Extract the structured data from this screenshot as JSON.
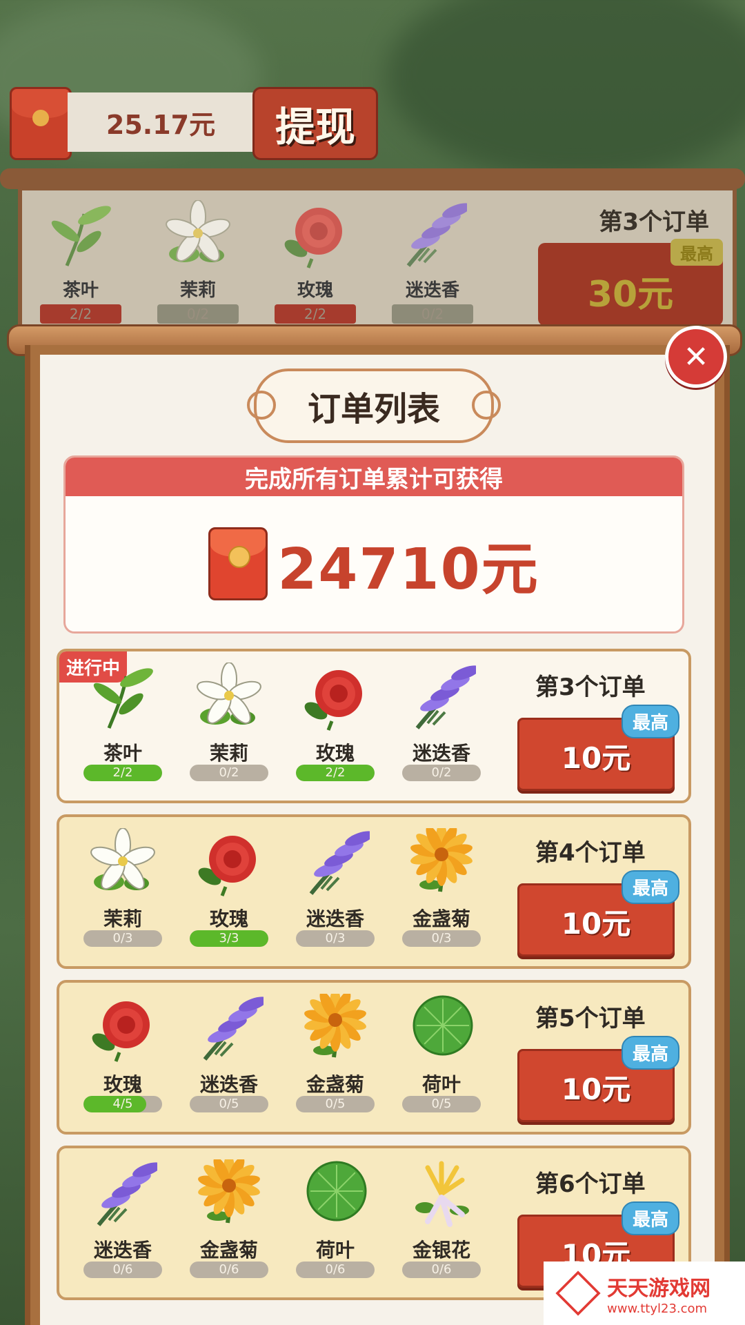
{
  "top": {
    "balance": "25.17元",
    "withdraw_label": "提现"
  },
  "bg_order": {
    "title": "第3个订单",
    "reward_tag": "最高",
    "reward_amount": "30元",
    "items": [
      {
        "name": "茶叶",
        "progress": "2/2",
        "icon": "tea-leaf-icon"
      },
      {
        "name": "茉莉",
        "progress": "0/2",
        "icon": "jasmine-icon"
      },
      {
        "name": "玫瑰",
        "progress": "2/2",
        "icon": "rose-icon"
      },
      {
        "name": "迷迭香",
        "progress": "0/2",
        "icon": "rosemary-icon"
      }
    ]
  },
  "modal": {
    "title": "订单列表",
    "summary_header": "完成所有订单累计可获得",
    "summary_total": "24710元",
    "status_active": "进行中"
  },
  "orders": [
    {
      "title": "第3个订单",
      "reward_tag": "最高",
      "reward_amount": "10元",
      "items": [
        {
          "name": "茶叶",
          "progress": "2/2",
          "ratio": 1,
          "icon": "tea-leaf-icon"
        },
        {
          "name": "茉莉",
          "progress": "0/2",
          "ratio": 0,
          "icon": "jasmine-icon"
        },
        {
          "name": "玫瑰",
          "progress": "2/2",
          "ratio": 1,
          "icon": "rose-icon"
        },
        {
          "name": "迷迭香",
          "progress": "0/2",
          "ratio": 0,
          "icon": "rosemary-icon"
        }
      ]
    },
    {
      "title": "第4个订单",
      "reward_tag": "最高",
      "reward_amount": "10元",
      "items": [
        {
          "name": "茉莉",
          "progress": "0/3",
          "ratio": 0,
          "icon": "jasmine-icon"
        },
        {
          "name": "玫瑰",
          "progress": "3/3",
          "ratio": 1,
          "icon": "rose-icon"
        },
        {
          "name": "迷迭香",
          "progress": "0/3",
          "ratio": 0,
          "icon": "rosemary-icon"
        },
        {
          "name": "金盏菊",
          "progress": "0/3",
          "ratio": 0,
          "icon": "marigold-icon"
        }
      ]
    },
    {
      "title": "第5个订单",
      "reward_tag": "最高",
      "reward_amount": "10元",
      "items": [
        {
          "name": "玫瑰",
          "progress": "4/5",
          "ratio": 0.8,
          "icon": "rose-icon"
        },
        {
          "name": "迷迭香",
          "progress": "0/5",
          "ratio": 0,
          "icon": "rosemary-icon"
        },
        {
          "name": "金盏菊",
          "progress": "0/5",
          "ratio": 0,
          "icon": "marigold-icon"
        },
        {
          "name": "荷叶",
          "progress": "0/5",
          "ratio": 0,
          "icon": "lotus-leaf-icon"
        }
      ]
    },
    {
      "title": "第6个订单",
      "reward_tag": "最高",
      "reward_amount": "10元",
      "items": [
        {
          "name": "迷迭香",
          "progress": "0/6",
          "ratio": 0,
          "icon": "rosemary-icon"
        },
        {
          "name": "金盏菊",
          "progress": "0/6",
          "ratio": 0,
          "icon": "marigold-icon"
        },
        {
          "name": "荷叶",
          "progress": "0/6",
          "ratio": 0,
          "icon": "lotus-leaf-icon"
        },
        {
          "name": "金银花",
          "progress": "0/6",
          "ratio": 0,
          "icon": "honeysuckle-icon"
        }
      ]
    }
  ],
  "watermark": {
    "name": "天天游戏网",
    "url": "www.ttyl23.com"
  },
  "colors": {
    "accent_red": "#d0472f",
    "progress_green": "#5cb82a",
    "tag_blue": "#4fb0e0",
    "frame_brown": "#a8703f"
  }
}
